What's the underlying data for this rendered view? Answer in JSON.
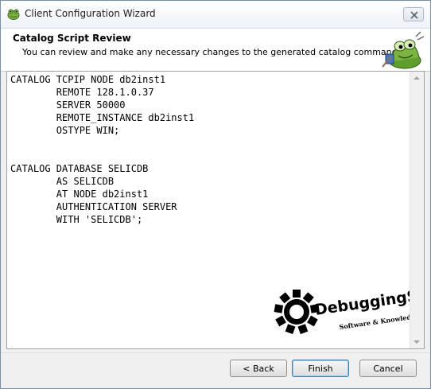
{
  "window": {
    "title": "Client Configuration Wizard"
  },
  "header": {
    "title": "Catalog Script Review",
    "subtitle": "You can review and make any necessary changes to the generated catalog commands"
  },
  "editor": {
    "script": "CATALOG TCPIP NODE db2inst1\n        REMOTE 128.1.0.37\n        SERVER 50000\n        REMOTE_INSTANCE db2inst1\n        OSTYPE WIN;\n\n\nCATALOG DATABASE SELICDB\n        AS SELICDB\n        AT NODE db2inst1\n        AUTHENTICATION SERVER\n        WITH 'SELICDB';"
  },
  "watermark": {
    "brand": "DebuggingSoft",
    "tagline": "Software & Knowledge"
  },
  "buttons": {
    "back": "< Back",
    "finish": "Finish",
    "cancel": "Cancel"
  },
  "icons": {
    "app": "frog-app-icon",
    "close": "close-icon",
    "mascot": "frog-mascot-icon",
    "watermark": "gear-logo-icon"
  },
  "colors": {
    "window_border": "#7a8ea6",
    "default_button_border": "#3c7fb1",
    "watermark": "#000000"
  }
}
